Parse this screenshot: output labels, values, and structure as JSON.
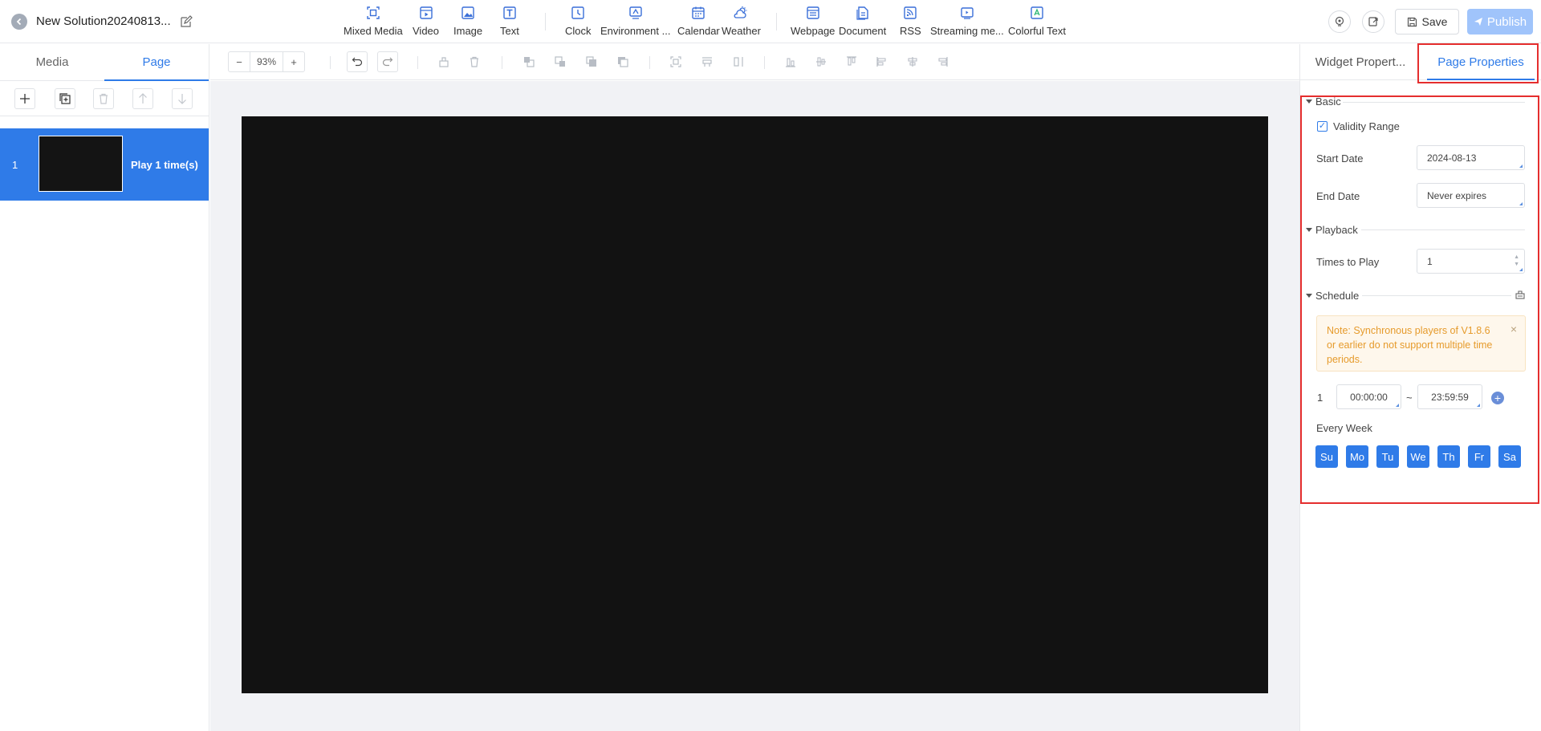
{
  "header": {
    "solution_title": "New Solution20240813...",
    "tools": [
      {
        "label": "Mixed Media",
        "icon": "mixed-media-icon"
      },
      {
        "label": "Video",
        "icon": "video-icon"
      },
      {
        "label": "Image",
        "icon": "image-icon"
      },
      {
        "label": "Text",
        "icon": "text-icon"
      },
      {
        "label": "Clock",
        "icon": "clock-icon"
      },
      {
        "label": "Environment ...",
        "icon": "environment-icon"
      },
      {
        "label": "Calendar",
        "icon": "calendar-icon"
      },
      {
        "label": "Weather",
        "icon": "weather-icon"
      },
      {
        "label": "Webpage",
        "icon": "webpage-icon"
      },
      {
        "label": "Document",
        "icon": "document-icon"
      },
      {
        "label": "RSS",
        "icon": "rss-icon"
      },
      {
        "label": "Streaming me...",
        "icon": "streaming-media-icon"
      },
      {
        "label": "Colorful Text",
        "icon": "colorful-text-icon"
      }
    ],
    "save_label": "Save",
    "publish_label": "Publish"
  },
  "left_panel": {
    "tabs": [
      "Media",
      "Page"
    ],
    "active_tab": "Page",
    "pages": [
      {
        "number": "1",
        "label": "Play 1 time(s)"
      }
    ]
  },
  "canvas_toolbar": {
    "zoom": "93%"
  },
  "right_panel": {
    "tabs": [
      "Widget Propert...",
      "Page Properties"
    ],
    "active_tab": "Page Properties",
    "basic": {
      "title": "Basic",
      "validity_label": "Validity Range",
      "validity_checked": true,
      "start_label": "Start Date",
      "start_value": "2024-08-13",
      "end_label": "End Date",
      "end_value": "Never expires"
    },
    "playback": {
      "title": "Playback",
      "times_label": "Times to Play",
      "times_value": "1"
    },
    "schedule": {
      "title": "Schedule",
      "note": "Note: Synchronous players of V1.8.6 or earlier do not support multiple time periods.",
      "period_index": "1",
      "start_time": "00:00:00",
      "separator": "~",
      "end_time": "23:59:59",
      "repeat_label": "Every Week",
      "days": [
        "Su",
        "Mo",
        "Tu",
        "We",
        "Th",
        "Fr",
        "Sa"
      ]
    }
  },
  "colors": {
    "accent": "#2f7be8",
    "highlight": "#e52e2e",
    "canvas": "#121212",
    "note_text": "#e69b2c"
  }
}
